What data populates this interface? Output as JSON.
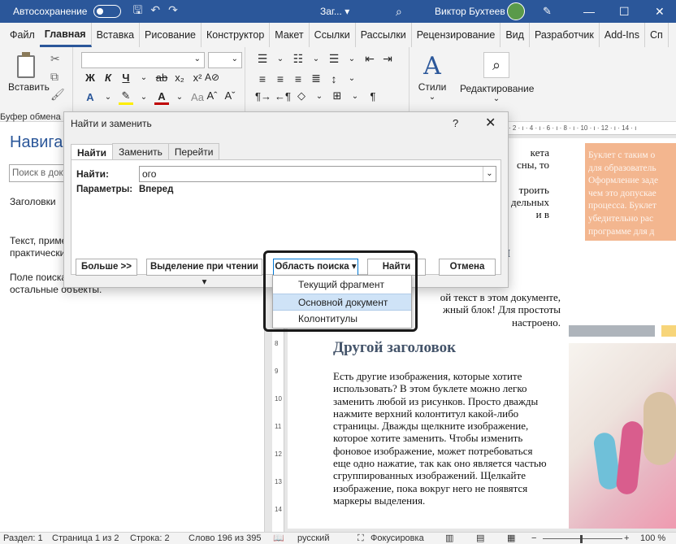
{
  "titlebar": {
    "autosave": "Автосохранение",
    "doc_title": "Заг...",
    "doc_title_chevron": "▾",
    "user": "Виктор Бухтеев",
    "minimize": "—",
    "restore": "☐",
    "close": "✕"
  },
  "ribbon_tabs": [
    "Файл",
    "Главная",
    "Вставка",
    "Рисование",
    "Конструктор",
    "Макет",
    "Ссылки",
    "Рассылки",
    "Рецензирование",
    "Вид",
    "Разработчик",
    "Add-Ins",
    "Сп"
  ],
  "ribbon": {
    "paste_label": "Вставить",
    "clipboard_group": "Буфер обмена",
    "styles_label": "Стили",
    "editing_label": "Редактирование",
    "bold": "Ж",
    "italic": "К",
    "underline": "Ч",
    "strike": "ab",
    "subscript": "x₂",
    "superscript": "x²",
    "grow": "Aˆ",
    "shrink": "Aˇ",
    "case": "Aa",
    "clear": "A⊘"
  },
  "nav": {
    "title": "Навигация",
    "search_placeholder": "Поиск в документе",
    "headings_tab": "Заголовки",
    "text1a": "Текст, приме",
    "text1b": "практически",
    "text2a": "Поле поиска",
    "text2b": "остальные объекты."
  },
  "document": {
    "ruler_h": "· 2 · ı · 4 · ı · 6 · ı · 8 · ı · 10 · ı · 12 · ı · 14 · ı",
    "para1_lines": [
      "кета",
      "сны, то",
      "",
      "троить",
      "дельных",
      "и в"
    ],
    "heading_partial": "ии",
    "para2_lines": [
      "ой текст в этом документе,",
      "жный блок! Для простоты",
      "настроено."
    ],
    "heading2": "Другой заголовок",
    "para3_lines": [
      "Есть другие изображения, которые хотите",
      "использовать? В этом буклете можно легко",
      "заменить любой из рисунков. Просто дважды",
      "нажмите верхний колонтитул какой-либо",
      "страницы. Дважды щелкните изображение,",
      "которое хотите заменить. Чтобы изменить",
      "фоновое изображение, может потребоваться",
      "еще одно нажатие, так как оно является частью",
      "сгруппированных изображений. Щелкайте",
      "изображение, пока вокруг него не появятся",
      "маркеры выделения."
    ],
    "sidebar_text": "Буклет с таким о для образователь Оформление заде чем это допускае процесса. Буклет убедительно рас программе для д"
  },
  "dialog": {
    "title": "Найти и заменить",
    "help": "?",
    "close": "✕",
    "tabs": [
      "Найти",
      "Заменить",
      "Перейти"
    ],
    "find_label": "Найти:",
    "find_value": "ого",
    "params_label": "Параметры:",
    "params_value": "Вперед",
    "more_button": "Больше >>",
    "reading_highlight": "Выделение при чтении ▾",
    "search_in": "Область поиска ▾",
    "find_next": "Найти далее",
    "cancel": "Отмена"
  },
  "search_menu": {
    "items": [
      "Текущий фрагмент",
      "Основной документ",
      "Колонтитулы"
    ],
    "selected_index": 1
  },
  "statusbar": {
    "section": "Раздел: 1",
    "page": "Страница 1 из 2",
    "line": "Строка: 2",
    "words": "Слово 196 из 395",
    "language": "русский",
    "focus": "Фокусировка",
    "zoom": "100 %"
  }
}
